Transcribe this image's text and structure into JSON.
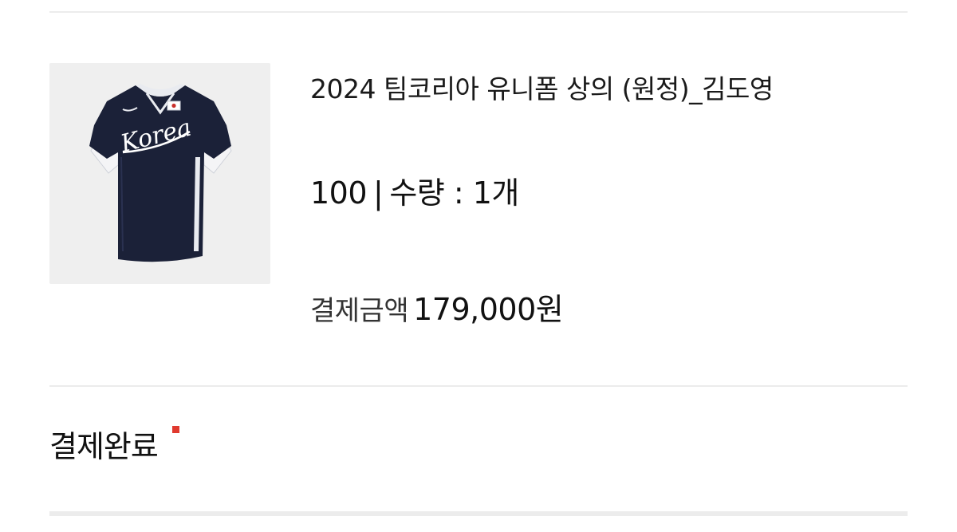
{
  "product": {
    "image_icon": "jersey-icon",
    "jersey_text": "Korea",
    "name": "2024 팀코리아 유니폼 상의 (원정)_김도영",
    "size": "100",
    "separator": "|",
    "quantity_label": "수량 : 1개"
  },
  "payment": {
    "label": "결제금액",
    "amount": "179,000원"
  },
  "order": {
    "status": "결제완료"
  },
  "colors": {
    "accent_red": "#e03a2f",
    "divider": "#ececec",
    "jersey_navy": "#1b2138"
  }
}
